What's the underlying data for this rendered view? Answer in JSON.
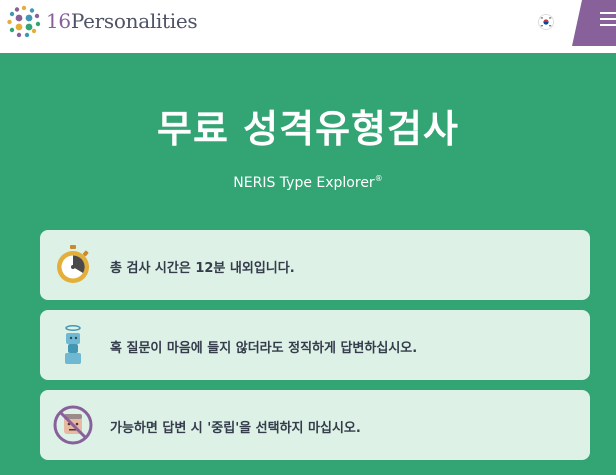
{
  "header": {
    "brand_number": "16",
    "brand_name": "Personalities",
    "logo_icon": "dots-circle-logo",
    "language_flag": "korea-flag-icon",
    "menu_icon": "hamburger-menu-icon",
    "menu_tab_color": "#88619a"
  },
  "hero": {
    "title": "무료 성격유형검사",
    "subtitle": "NERIS Type Explorer",
    "subtitle_mark": "®"
  },
  "info_cards": [
    {
      "text": "총 검사 시간은 12분 내외입니다.",
      "icon": "stopwatch-icon"
    },
    {
      "text": "혹 질문이 마음에 들지 않더라도 정직하게 답변하십시오.",
      "icon": "stacked-figure-halo-icon"
    },
    {
      "text": "가능하면 답변 시 '중립'을 선택하지 마십시오.",
      "icon": "no-neutral-face-icon"
    }
  ],
  "colors": {
    "background": "#33a474",
    "card": "#ddf1e7",
    "text": "#343c4b",
    "brand_purple": "#88619a"
  }
}
